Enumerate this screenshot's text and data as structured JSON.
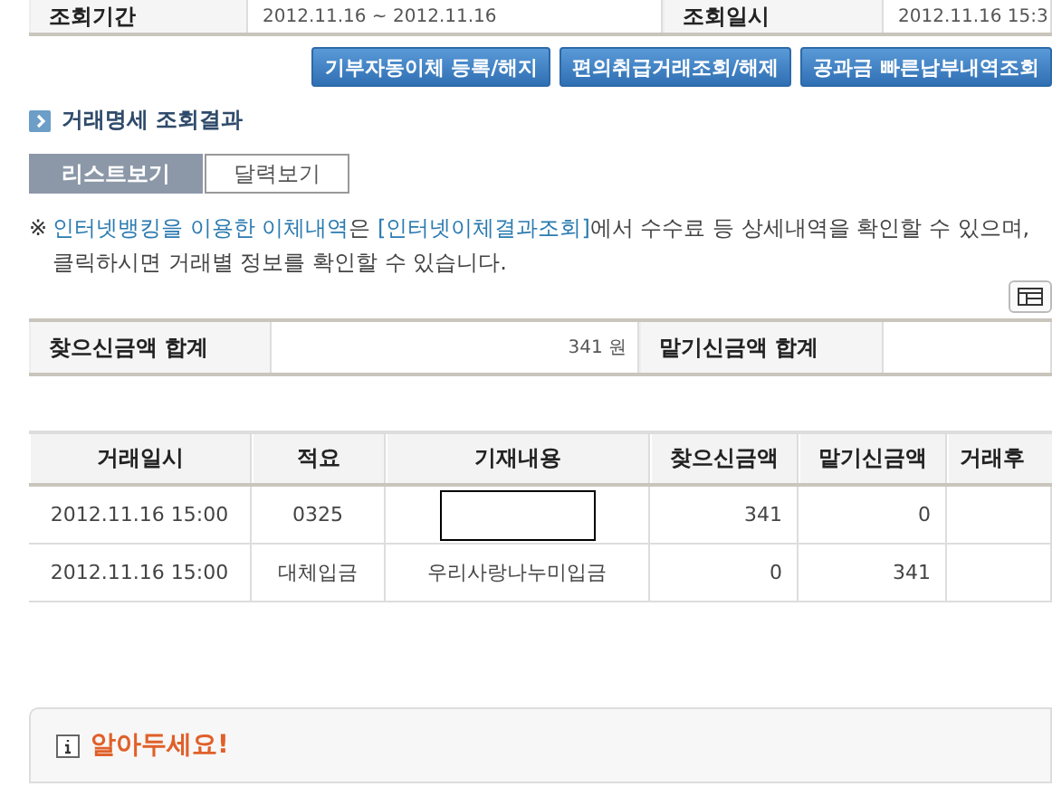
{
  "period_row": [
    {
      "label": "조회기간",
      "value": "2012.11.16 ~ 2012.11.16"
    },
    {
      "label": "조회일시",
      "value": "2012.11.16 15:3"
    }
  ],
  "action_buttons": [
    "기부자동이체 등록/해지",
    "편의취급거래조회/해제",
    "공과금 빠른납부내역조회"
  ],
  "section_title": "거래명세 조회결과",
  "view_tabs": [
    {
      "label": "리스트보기",
      "selected": true
    },
    {
      "label": "달력보기",
      "selected": false
    }
  ],
  "notice": {
    "mark": "※",
    "lines": [
      [
        {
          "kind": "link",
          "text": "인터넷뱅킹을 이용한 이체내역"
        },
        {
          "kind": "text",
          "text": "은 "
        },
        {
          "kind": "link",
          "text": "[인터넷이체결과조회]"
        },
        {
          "kind": "text",
          "text": "에서 수수료 등 상세내역을 확인할 수 있으며,"
        }
      ],
      [
        {
          "kind": "text",
          "text": "클릭하시면 거래별 정보를 확인할 수 있습니다."
        }
      ]
    ]
  },
  "totals": [
    {
      "label": "찾으신금액 합계",
      "value": "341 원"
    },
    {
      "label": "맡기신금액 합계"
    }
  ],
  "table": {
    "columns": [
      "거래일시",
      "적요",
      "기재내용",
      "찾으신금액",
      "맡기신금액",
      "거래후"
    ],
    "rows": [
      {
        "cells": [
          "2012.11.16 15:00",
          "0325",
          {
            "redacted": true
          },
          "341",
          "0"
        ]
      },
      {
        "cells": [
          "2012.11.16 15:00",
          "대체입금",
          "우리사랑나누미입금",
          "0",
          "341"
        ]
      }
    ]
  },
  "info_box": {
    "title": "알아두세요!"
  }
}
